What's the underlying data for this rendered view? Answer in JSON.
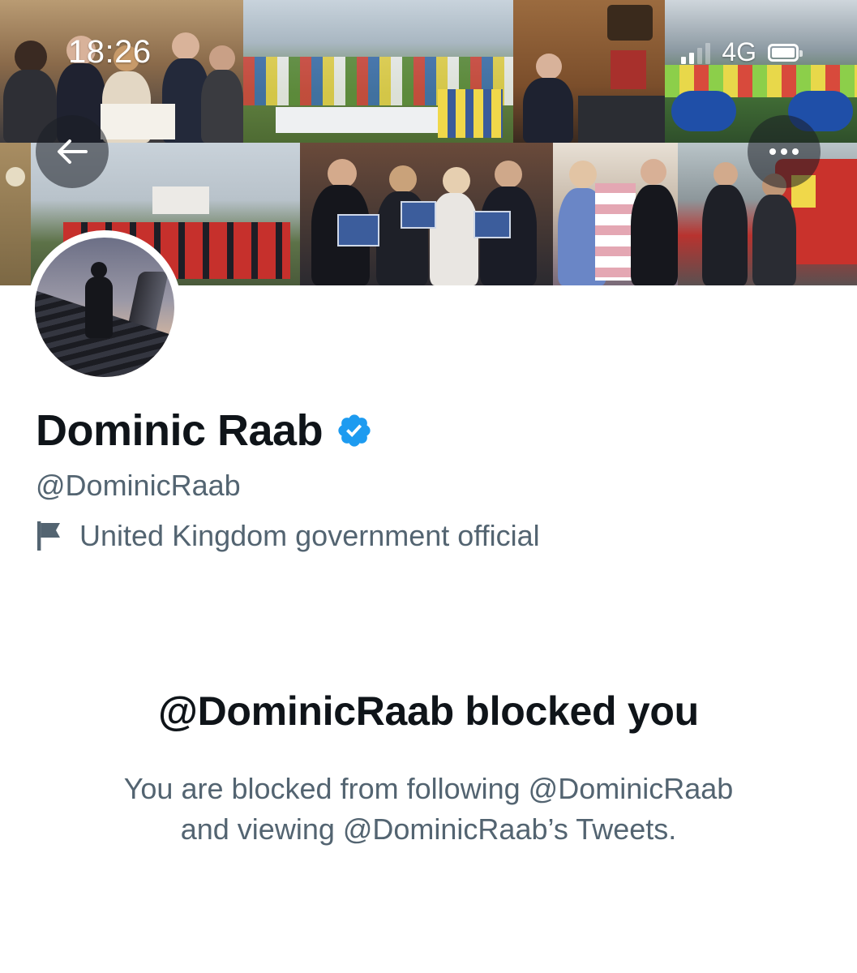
{
  "status_bar": {
    "time": "18:26",
    "network": "4G",
    "icons": [
      "signal-icon",
      "battery-icon"
    ]
  },
  "header": {
    "back_icon": "arrow-left-icon",
    "more_icon": "more-options-icon"
  },
  "profile": {
    "name": "Dominic Raab",
    "verified_icon": "verified-badge-icon",
    "handle": "@DominicRaab",
    "label_icon": "flag-icon",
    "label": "United Kingdom government official"
  },
  "blocked": {
    "title": "@DominicRaab blocked you",
    "line1": "You are blocked from following @DominicRaab",
    "line2": "and viewing @DominicRaab’s Tweets."
  },
  "colors": {
    "primary_text": "#0f1419",
    "secondary_text": "#536471",
    "verified_blue": "#1d9bf0",
    "background": "#ffffff"
  }
}
